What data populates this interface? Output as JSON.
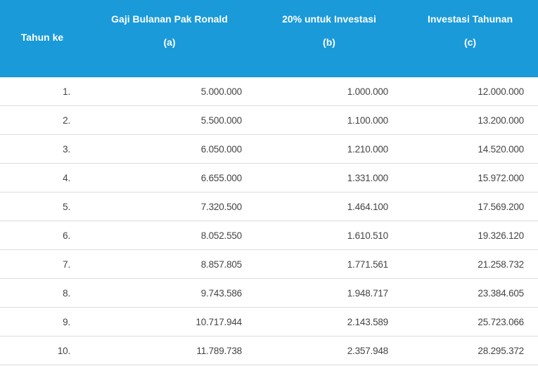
{
  "header": {
    "year": "Tahun ke",
    "col_a_title": "Gaji Bulanan Pak Ronald",
    "col_a_tag": "(a)",
    "col_b_title": "20% untuk Investasi",
    "col_b_tag": "(b)",
    "col_c_title": "Investasi Tahunan",
    "col_c_tag": "(c)"
  },
  "colors": {
    "header_bg": "#1a9ad9",
    "header_text": "#ffffff",
    "row_text": "#444444",
    "divider": "#dcdcdc"
  },
  "rows": [
    {
      "year": "1.",
      "a": "5.000.000",
      "b": "1.000.000",
      "c": "12.000.000"
    },
    {
      "year": "2.",
      "a": "5.500.000",
      "b": "1.100.000",
      "c": "13.200.000"
    },
    {
      "year": "3.",
      "a": "6.050.000",
      "b": "1.210.000",
      "c": "14.520.000"
    },
    {
      "year": "4.",
      "a": "6.655.000",
      "b": "1.331.000",
      "c": "15.972.000"
    },
    {
      "year": "5.",
      "a": "7.320.500",
      "b": "1.464.100",
      "c": "17.569.200"
    },
    {
      "year": "6.",
      "a": "8.052.550",
      "b": "1.610.510",
      "c": "19.326.120"
    },
    {
      "year": "7.",
      "a": "8.857.805",
      "b": "1.771.561",
      "c": "21.258.732"
    },
    {
      "year": "8.",
      "a": "9.743.586",
      "b": "1.948.717",
      "c": "23.384.605"
    },
    {
      "year": "9.",
      "a": "10.717.944",
      "b": "2.143.589",
      "c": "25.723.066"
    },
    {
      "year": "10.",
      "a": "11.789.738",
      "b": "2.357.948",
      "c": "28.295.372"
    }
  ]
}
